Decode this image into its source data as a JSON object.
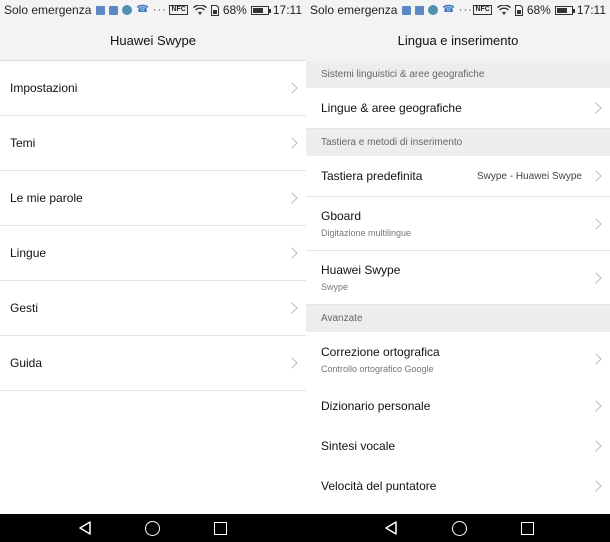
{
  "status_bar": {
    "carrier": "Solo emergenza",
    "nfc": "NFC",
    "battery_pct": "68%",
    "battery_level": 0.68,
    "time": "17:11",
    "more": "···"
  },
  "left_screen": {
    "title": "Huawei Swype",
    "items": [
      {
        "label": "Impostazioni"
      },
      {
        "label": "Temi"
      },
      {
        "label": "Le mie parole"
      },
      {
        "label": "Lingue"
      },
      {
        "label": "Gesti"
      },
      {
        "label": "Guida"
      }
    ]
  },
  "right_screen": {
    "title": "Lingua e inserimento",
    "sections": {
      "languages": "Sistemi linguistici & aree geografiche",
      "keyboard": "Tastiera e metodi di inserimento",
      "advanced": "Avanzate"
    },
    "items": {
      "languages_regions": {
        "label": "Lingue & aree geografiche"
      },
      "default_keyboard": {
        "label": "Tastiera predefinita",
        "value": "Swype - Huawei Swype"
      },
      "gboard": {
        "label": "Gboard",
        "sub": "Digitazione multilingue"
      },
      "huawei_swype": {
        "label": "Huawei Swype",
        "sub": "Swype"
      },
      "spell_check": {
        "label": "Correzione ortografica",
        "sub": "Controllo ortografico Google"
      },
      "personal_dictionary": {
        "label": "Dizionario personale"
      },
      "tts": {
        "label": "Sintesi vocale"
      },
      "pointer_speed": {
        "label": "Velocità del puntatore"
      }
    }
  },
  "colors": {
    "background": "#ffffff",
    "header": "#f3f3f3",
    "section": "#ededed",
    "navbar": "#000000"
  }
}
